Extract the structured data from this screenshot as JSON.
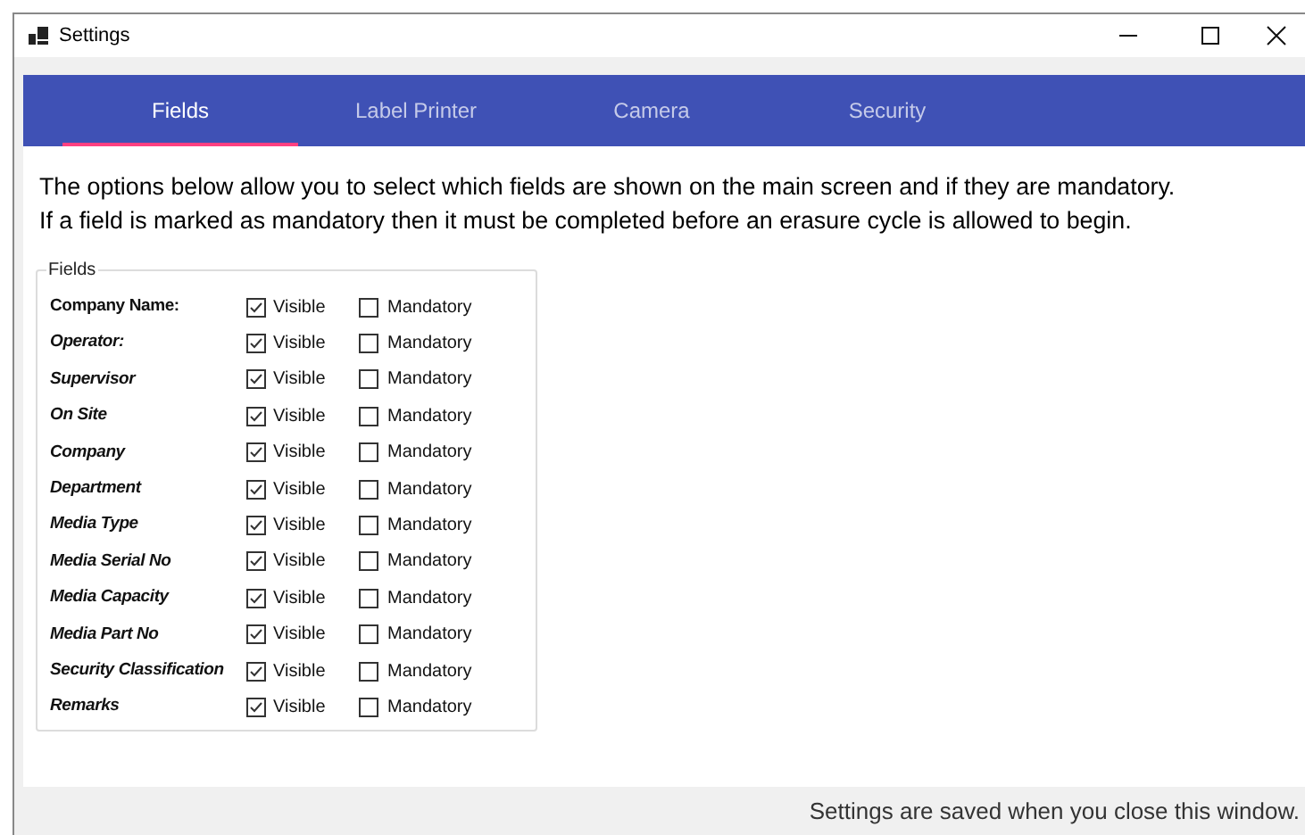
{
  "window": {
    "title": "Settings"
  },
  "tabs": [
    {
      "label": "Fields",
      "selected": true
    },
    {
      "label": "Label Printer",
      "selected": false
    },
    {
      "label": "Camera",
      "selected": false
    },
    {
      "label": "Security",
      "selected": false
    }
  ],
  "description": [
    "The options below allow you to select which fields are shown on the main screen and if they are mandatory.",
    "If a field is marked as mandatory then it must be completed before an erasure cycle is allowed to begin."
  ],
  "fields_group": {
    "title": "Fields",
    "rows": [
      {
        "label": "Company Name:",
        "italic": false,
        "visible_label": "Visible",
        "visible": true,
        "mandatory_label": "Mandatory",
        "mandatory": false
      },
      {
        "label": "Operator:",
        "italic": true,
        "visible_label": "Visible",
        "visible": true,
        "mandatory_label": "Mandatory",
        "mandatory": false
      },
      {
        "label": "Supervisor",
        "italic": true,
        "visible_label": "Visible",
        "visible": true,
        "mandatory_label": "Mandatory",
        "mandatory": false
      },
      {
        "label": "On Site",
        "italic": true,
        "visible_label": "Visible",
        "visible": true,
        "mandatory_label": "Mandatory",
        "mandatory": false
      },
      {
        "label": "Company",
        "italic": true,
        "visible_label": "Visible",
        "visible": true,
        "mandatory_label": "Mandatory",
        "mandatory": false
      },
      {
        "label": "Department",
        "italic": true,
        "visible_label": "Visible",
        "visible": true,
        "mandatory_label": "Mandatory",
        "mandatory": false
      },
      {
        "label": "Media Type",
        "italic": true,
        "visible_label": "Visible",
        "visible": true,
        "mandatory_label": "Mandatory",
        "mandatory": false
      },
      {
        "label": "Media Serial No",
        "italic": true,
        "visible_label": "Visible",
        "visible": true,
        "mandatory_label": "Mandatory",
        "mandatory": false
      },
      {
        "label": "Media Capacity",
        "italic": true,
        "visible_label": "Visible",
        "visible": true,
        "mandatory_label": "Mandatory",
        "mandatory": false
      },
      {
        "label": "Media Part No",
        "italic": true,
        "visible_label": "Visible",
        "visible": true,
        "mandatory_label": "Mandatory",
        "mandatory": false
      },
      {
        "label": "Security Classification",
        "italic": true,
        "visible_label": "Visible",
        "visible": true,
        "mandatory_label": "Mandatory",
        "mandatory": false
      },
      {
        "label": "Remarks",
        "italic": true,
        "visible_label": "Visible",
        "visible": true,
        "mandatory_label": "Mandatory",
        "mandatory": false
      }
    ]
  },
  "status_bar": "Settings are saved when you close this window."
}
